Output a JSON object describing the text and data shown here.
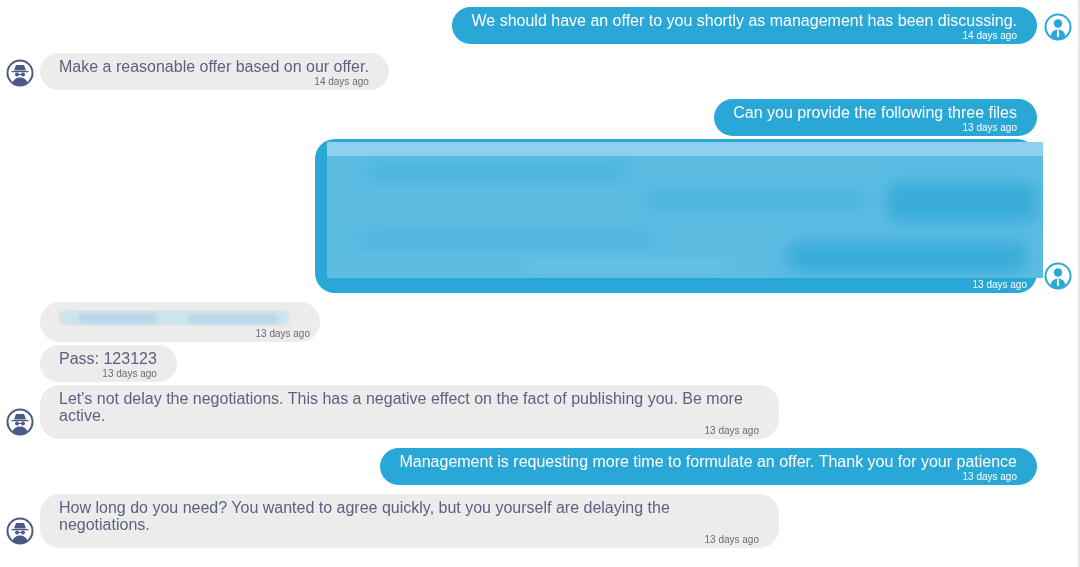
{
  "messages": [
    {
      "outgoing": true,
      "kind": "text",
      "text": "We should have an offer to you shortly as management has been discussing.",
      "time": "14 days ago",
      "avatar": true
    },
    {
      "outgoing": false,
      "kind": "text",
      "text": "Make a reasonable offer based on our offer.",
      "time": "14 days ago",
      "avatar": true
    },
    {
      "outgoing": true,
      "kind": "text",
      "text": "Can you provide the following three files",
      "time": "13 days ago",
      "avatar": false
    },
    {
      "outgoing": true,
      "kind": "blurblock",
      "time": "13 days ago",
      "avatar": true
    },
    {
      "outgoing": false,
      "kind": "blurline",
      "time": "13 days ago",
      "avatar": false
    },
    {
      "outgoing": false,
      "kind": "text",
      "text": "Pass: 123123",
      "time": "13 days ago",
      "avatar": false
    },
    {
      "outgoing": false,
      "kind": "text",
      "text": "Let's not delay the negotiations. This has a negative effect on the fact of publishing you. Be more active.",
      "time": "13 days ago",
      "avatar": true
    },
    {
      "outgoing": true,
      "kind": "text",
      "text": "Management is requesting more time to formulate an offer.  Thank you for your patience",
      "time": "13 days ago",
      "avatar": false
    },
    {
      "outgoing": false,
      "kind": "text",
      "text": "How long do you need? You wanted to agree quickly, but you yourself are delaying the negotiations.",
      "time": "13 days ago",
      "avatar": true
    }
  ]
}
